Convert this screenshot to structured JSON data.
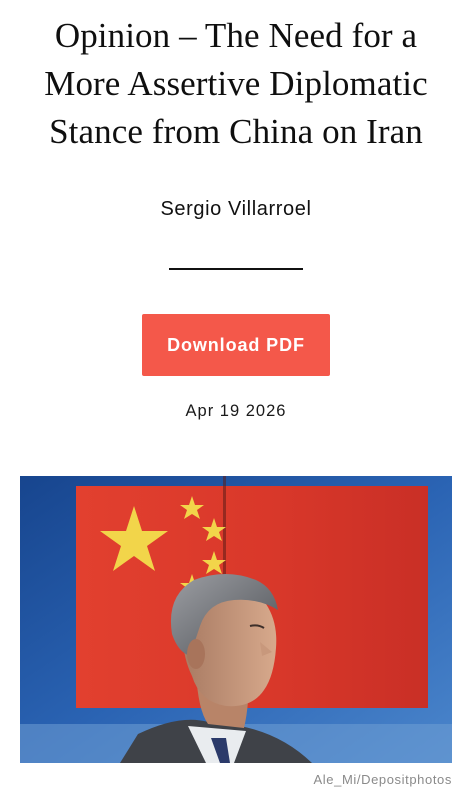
{
  "article": {
    "title": "Opinion – The Need for a More Assertive Diplomatic Stance from China on Iran",
    "author": "Sergio Villarroel",
    "download_label": "Download PDF",
    "date": "Apr 19 2026"
  },
  "image": {
    "subject": "flag-of-china-with-man-in-profile",
    "credit": "Ale_Mi/Depositphotos"
  },
  "colors": {
    "accent": "#f4584a",
    "flag_red": "#d6372b",
    "flag_star": "#f2d54a",
    "backdrop_blue": "#1f4f9a"
  }
}
